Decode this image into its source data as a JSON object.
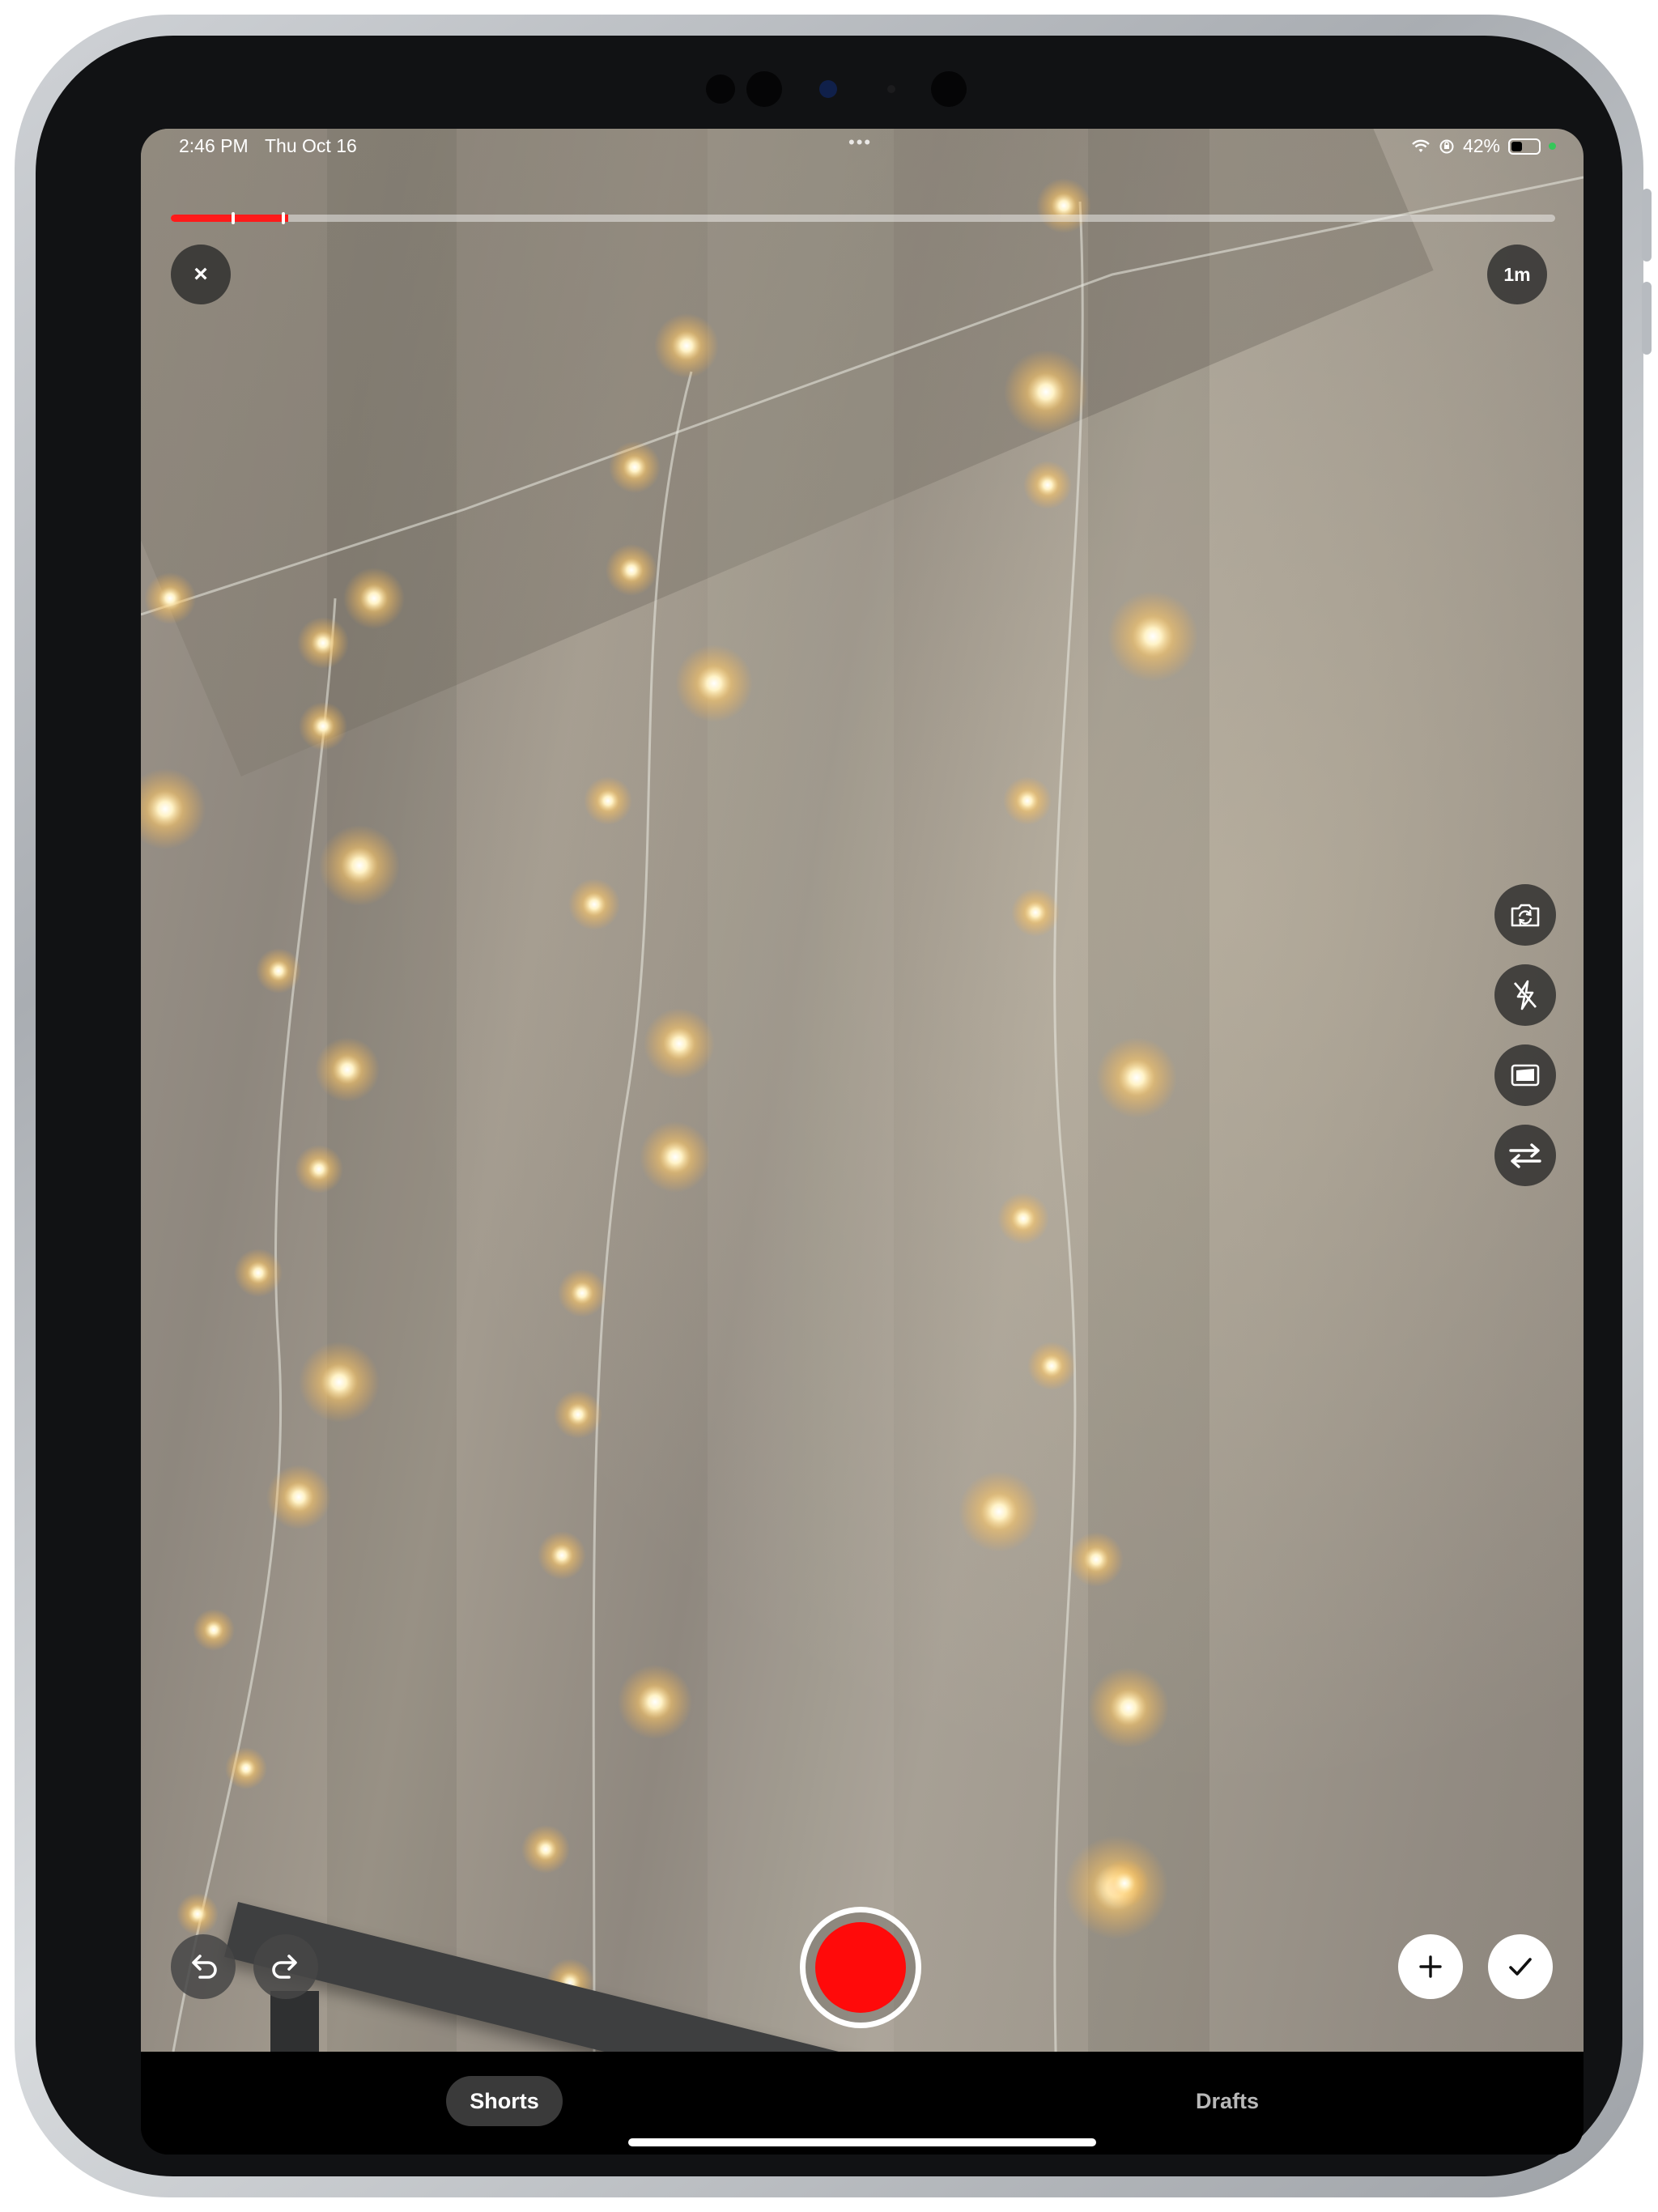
{
  "status_bar": {
    "time": "2:46 PM",
    "date": "Thu Oct 16",
    "multitask_dots": "•••",
    "battery_percent": "42%",
    "battery_level": 0.42,
    "icons": [
      "wifi-icon",
      "orientation-lock-icon",
      "battery-icon",
      "camera-in-use-dot"
    ]
  },
  "recording": {
    "progress_fraction": 0.085,
    "segment_marker_fractions": [
      0.045,
      0.081
    ]
  },
  "top_controls": {
    "close_label": "×",
    "timer_label": "1m"
  },
  "side_tools": [
    {
      "name": "flip-camera",
      "icon": "camera-rotate-icon"
    },
    {
      "name": "flash-off",
      "icon": "flash-off-icon"
    },
    {
      "name": "green-screen",
      "icon": "picture-frame-icon"
    },
    {
      "name": "swap",
      "icon": "swap-arrows-icon"
    }
  ],
  "bottom_controls": {
    "undo_icon": "undo-icon",
    "redo_icon": "redo-icon",
    "record_icon": "record-button",
    "add_icon": "plus-icon",
    "done_icon": "checkmark-icon"
  },
  "tabs": [
    {
      "label": "Shorts",
      "selected": true
    },
    {
      "label": "Drafts",
      "selected": false
    }
  ],
  "colors": {
    "record_red": "#ff0a0a",
    "progress_red": "#ff1a1a",
    "tab_selected_bg": "#3a3a3a",
    "camera_active_dot": "#34c759"
  }
}
